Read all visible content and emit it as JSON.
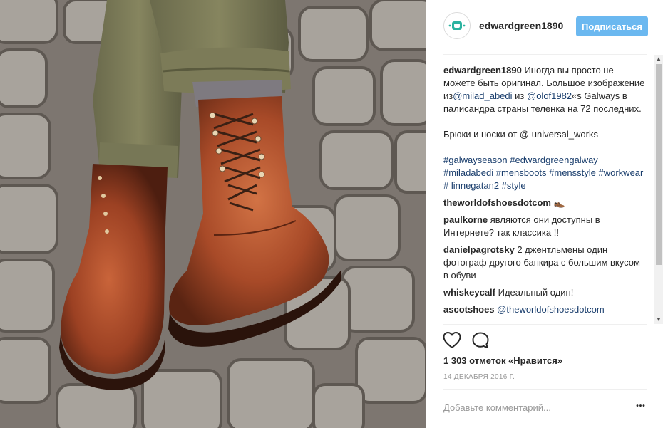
{
  "post": {
    "username": "edwardgreen1890",
    "follow_label": "Подписаться",
    "caption": {
      "username": "edwardgreen1890",
      "text1": " Иногда вы просто не можете быть оригинал. Большое изображение из",
      "mention1": "@milad_abedi",
      "text2": " из ",
      "mention2": "@olof1982",
      "text3": "«s Galways в палисандра страны теленка на 72 последних.",
      "text4": "Брюки и носки от @ universal_works",
      "hashtags": "#galwayseason #edwardgreengalway #miladabedi #mensboots #mensstyle #workwear # linnegatan2 #style"
    },
    "comments": [
      {
        "username": "theworldofshoesdotcom",
        "text": " 👞"
      },
      {
        "username": "paulkorne",
        "text": " являются они доступны в Интернете? так классика !!"
      },
      {
        "username": "danielpagrotsky",
        "text": " 2 джентльмены один фотограф другого банкира с большим вкусом в обуви"
      },
      {
        "username": "whiskeycalf",
        "text": " Идеальный один!"
      },
      {
        "username": "ascotshoes",
        "text": " ",
        "mention": "@theworldofshoesdotcom"
      }
    ],
    "likes": "1 303 отметок «Нравится»",
    "date": "14 ДЕКАБРЯ 2016 Г.",
    "comment_placeholder": "Добавьте комментарий...",
    "more_label": "•••",
    "icons": {
      "like": "heart-icon",
      "comment": "comment-bubble-icon",
      "more": "more-dots-icon"
    }
  },
  "colors": {
    "follow": "#6bb8f0",
    "link": "#1a3e6d",
    "muted": "#999999"
  }
}
